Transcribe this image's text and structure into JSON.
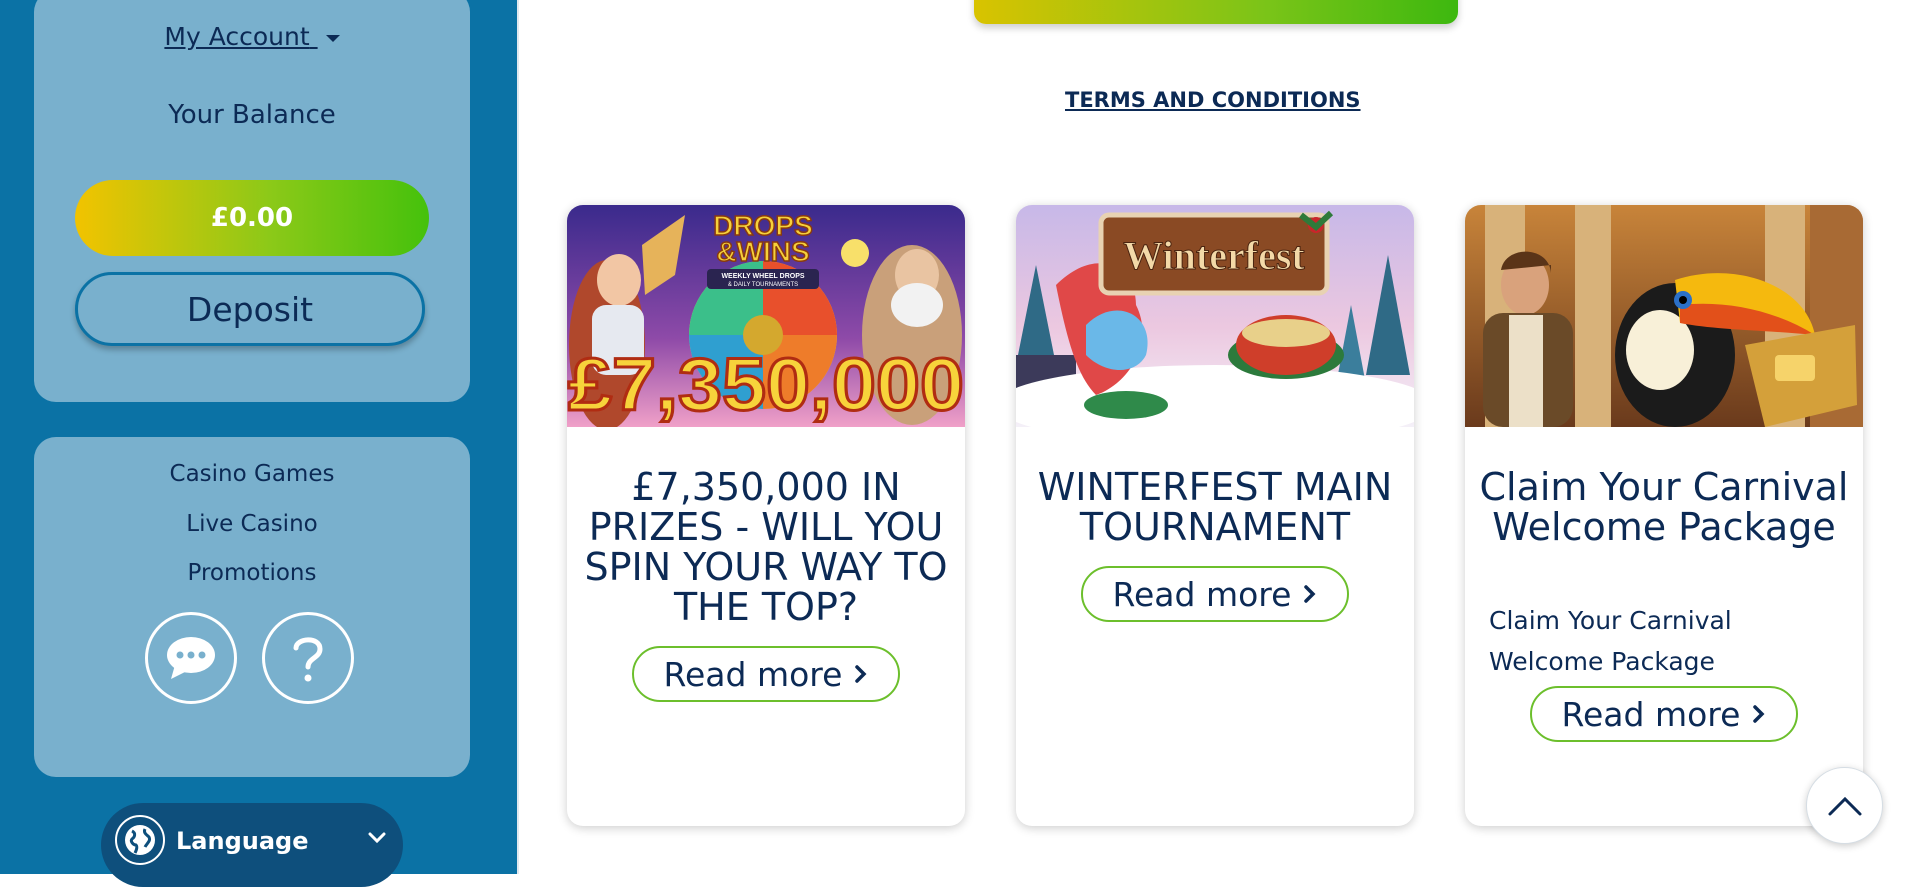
{
  "sidebar": {
    "account": {
      "my_account_label": "My Account",
      "balance_label": "Your Balance",
      "balance_value": "£0.00",
      "deposit_label": "Deposit"
    },
    "nav": {
      "items": [
        {
          "label": "Casino Games"
        },
        {
          "label": "Live Casino"
        },
        {
          "label": "Promotions"
        }
      ],
      "chat_icon": "chat-bubble-icon",
      "help_icon": "question-mark-icon"
    },
    "language": {
      "label": "Language",
      "icon": "globe-icon"
    }
  },
  "main": {
    "terms_link": "TERMS AND CONDITIONS",
    "promos": [
      {
        "image_text_top": "DROPS &WINS",
        "image_text_sub": "WEEKLY WHEEL DROPS & DAILY TOURNAMENTS",
        "image_text_amount": "£7,350,000",
        "title": "£7,350,000 IN PRIZES - WILL YOU SPIN YOUR WAY TO THE TOP?",
        "description": "",
        "read_more": "Read more"
      },
      {
        "image_text_top": "Winterfest",
        "title": "WINTERFEST MAIN TOURNAMENT",
        "description": "",
        "read_more": "Read more"
      },
      {
        "title": "Claim Your Carnival Welcome Package",
        "description": "Claim Your Carnival Welcome Package",
        "read_more": "Read more"
      }
    ],
    "scroll_top_icon": "chevron-up-icon"
  },
  "colors": {
    "sidebar_bg": "#0b72a5",
    "panel_bg": "#79b0cd",
    "text_navy": "#0c2a55",
    "accent_green": "#6cbf2c",
    "accent_yellow": "#f2c300"
  }
}
